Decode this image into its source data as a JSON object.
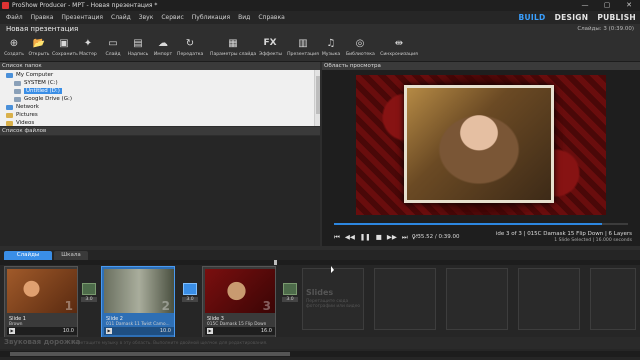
{
  "window": {
    "title": "ProShow Producer - MPT - Новая презентация *",
    "buttons": [
      "—",
      "▢",
      "✕"
    ]
  },
  "menu": [
    "Файл",
    "Правка",
    "Презентация",
    "Слайд",
    "Звук",
    "Сервис",
    "Публикация",
    "Вид",
    "Справка"
  ],
  "modes": {
    "build": "BUILD",
    "design": "DESIGN",
    "publish": "PUBLISH",
    "active": "BUILD"
  },
  "project": {
    "name": "Новая презентация",
    "slides_count": "Слайды: 3 (0:39.00)"
  },
  "toolbar": [
    {
      "label": "Создать",
      "icon": "new-icon",
      "glyph": "⊕"
    },
    {
      "label": "Открыть",
      "icon": "open-icon",
      "glyph": "📂"
    },
    {
      "label": "Сохранить",
      "icon": "save-icon",
      "glyph": "▣"
    },
    {
      "label": "Мастер",
      "icon": "wizard-icon",
      "glyph": "✦"
    },
    {
      "label": "Слайд",
      "icon": "slide-icon",
      "glyph": "▭"
    },
    {
      "label": "Надпись",
      "icon": "caption-icon",
      "glyph": "▤"
    },
    {
      "label": "Импорт",
      "icon": "import-icon",
      "glyph": "☁"
    },
    {
      "label": "Передатка",
      "icon": "transfer-icon",
      "glyph": "↻"
    },
    {
      "label": "Параметры слайда",
      "icon": "slide-options-icon",
      "glyph": "▦"
    },
    {
      "label": "Эффекты",
      "icon": "effects-icon",
      "glyph": "FX"
    },
    {
      "label": "Презентация",
      "icon": "show-icon",
      "glyph": "▥"
    },
    {
      "label": "Музыка",
      "icon": "music-icon",
      "glyph": "♫"
    },
    {
      "label": "Библиотека",
      "icon": "library-icon",
      "glyph": "◎"
    },
    {
      "label": "Синхронизация",
      "icon": "sync-icon",
      "glyph": "⇹"
    }
  ],
  "folders": {
    "header": "Список папок",
    "items": [
      {
        "label": "My Computer",
        "color": "#4a90d9"
      },
      {
        "label": "SYSTEM (C:)",
        "color": "#8aa0b8"
      },
      {
        "label": "Untitled (D:)",
        "color": "#8aa0b8",
        "selected": true
      },
      {
        "label": "Google Drive (G:)",
        "color": "#8aa0b8"
      },
      {
        "label": "Network",
        "color": "#4a90d9"
      },
      {
        "label": "Pictures",
        "color": "#d9b04a"
      },
      {
        "label": "Videos",
        "color": "#d9b04a"
      }
    ]
  },
  "files": {
    "header": "Список файлов"
  },
  "preview": {
    "header": "Область просмотра",
    "timecode": "0:35.52 / 0:39.00",
    "progress": 0.91,
    "slide_info": "ide 3 of 3  |  015C Damask 15 Flip Down  |  6 Layers",
    "slide_info_sub": "1 Slide Selected  |  16.000 seconds"
  },
  "tabs": {
    "slides": "Слайды",
    "timeline": "Шкала"
  },
  "slides": [
    {
      "title": "Slide 1",
      "subtitle": "Brown",
      "num": "1",
      "duration": "10.0"
    },
    {
      "title": "Slide 2",
      "subtitle": "011 Damask 11 Twist Camo...",
      "num": "2",
      "duration": "10.0"
    },
    {
      "title": "Slide 3",
      "subtitle": "015C Damask 15 Flip Down",
      "num": "3",
      "duration": "16.0"
    }
  ],
  "transitions": [
    "3.0",
    "3.0",
    "3.0"
  ],
  "empty_hint": {
    "title": "Slides",
    "text": "Перетащите сюда фотографии или видео"
  },
  "audio": {
    "label": "Звуковая дорожка",
    "hint": "Перетащите музыку в эту область. Выполните двойной щелчок для редактирования."
  }
}
